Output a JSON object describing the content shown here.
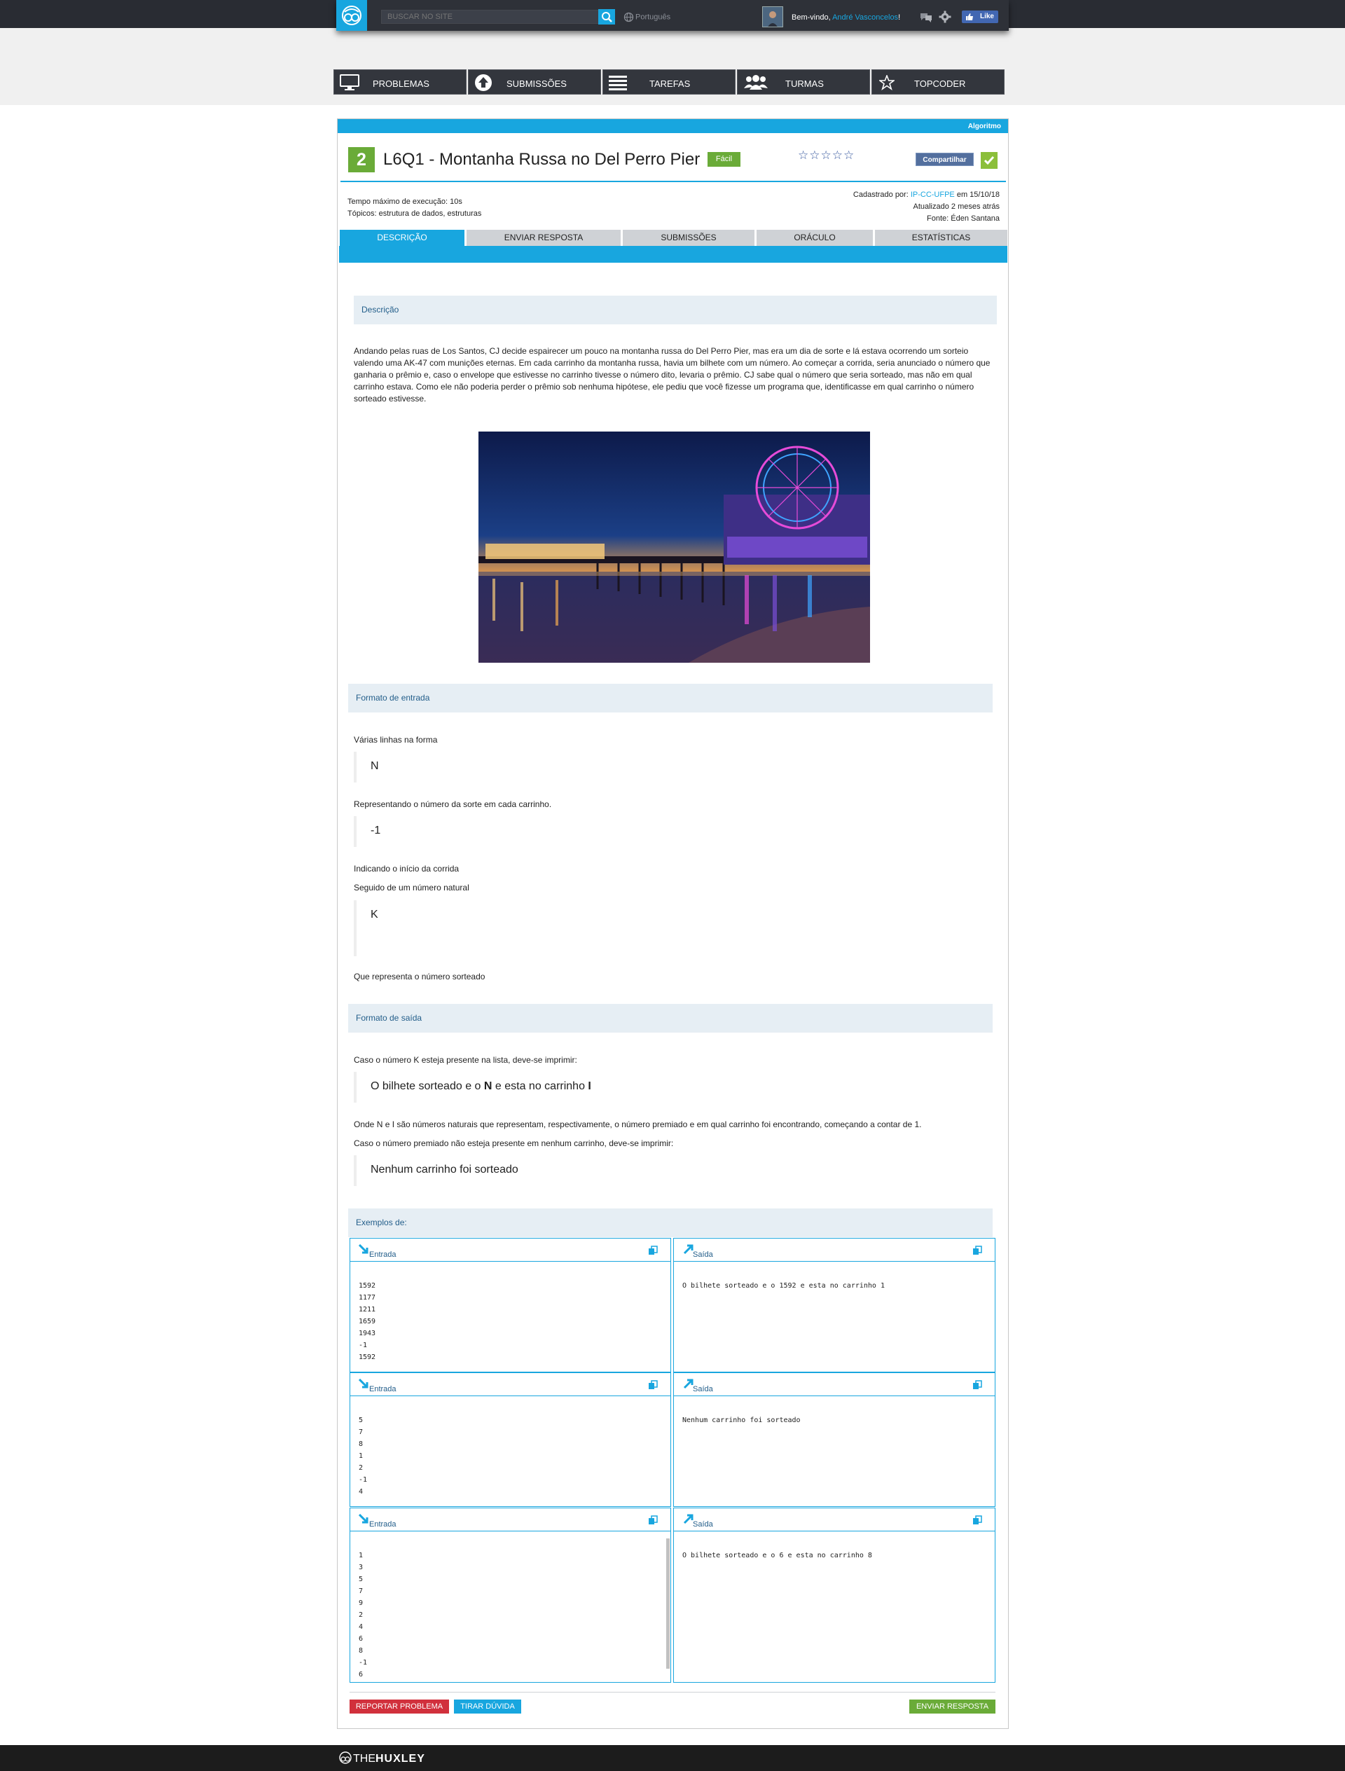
{
  "header": {
    "search_placeholder": "BUSCAR NO SITE",
    "language": "Português",
    "welcome_prefix": "Bem-vindo, ",
    "user_name": "André Vasconcelos",
    "welcome_suffix": "!",
    "like_label": "Like"
  },
  "nav": [
    {
      "label": "PROBLEMAS",
      "icon": "monitor-icon"
    },
    {
      "label": "SUBMISSÕES",
      "icon": "upload-icon"
    },
    {
      "label": "TAREFAS",
      "icon": "list-icon"
    },
    {
      "label": "TURMAS",
      "icon": "group-icon"
    },
    {
      "label": "TOPCODER",
      "icon": "star-icon"
    }
  ],
  "problem": {
    "category": "Algoritmo",
    "number": "2",
    "title": "L6Q1 - Montanha Russa no Del Perro Pier",
    "difficulty": "Fácil",
    "stars": "☆☆☆☆☆",
    "share_label": "Compartilhar",
    "time_limit": "Tempo máximo de execução: 10s",
    "topics": "Tópicos: estrutura de dados, estruturas",
    "registered_prefix": "Cadastrado por: ",
    "registered_by": "IP-CC-UFPE",
    "registered_suffix": " em 15/10/18",
    "updated": "Atualizado 2 meses atrás",
    "source": "Fonte: Éden Santana"
  },
  "tabs": [
    {
      "label": "DESCRIÇÃO",
      "active": true
    },
    {
      "label": "ENVIAR RESPOSTA",
      "active": false
    },
    {
      "label": "SUBMISSÕES",
      "active": false
    },
    {
      "label": "ORÁCULO",
      "active": false
    },
    {
      "label": "ESTATÍSTICAS",
      "active": false
    }
  ],
  "description": {
    "heading": "Descrição",
    "lines": [
      "Andando pelas ruas de Los Santos, CJ decide espairecer um pouco na montanha russa do Del Perro Pier, mas era um dia de sorte e lá estava ocorrendo um sorteio",
      "valendo uma AK-47 com munições eternas. Em cada carrinho da montanha russa, havia um bilhete com um número. Ao começar a corrida, seria anunciado o número que",
      "ganharia o prêmio e, caso o envelope que estivesse no carrinho tivesse o número dito, levaria o prêmio. CJ  sabe qual o número que seria sorteado, mas não em qual",
      "carrinho estava. Como ele não poderia perder o prêmio sob nenhuma hipótese, ele pediu que você fizesse um programa que, identificasse em qual carrinho o número",
      "sorteado estivesse."
    ]
  },
  "input_format": {
    "heading": "Formato de entrada",
    "line1": "Várias linhas na forma",
    "q1": "N",
    "line2": "Representando o número da sorte em cada carrinho.",
    "q2": "-1",
    "line3": "Indicando o início da corrida",
    "line4": "Seguido de um número natural",
    "q3": "K",
    "line5": "Que representa o número sorteado"
  },
  "output_format": {
    "heading": "Formato de saída",
    "line1": "Caso o número K esteja presente na lista, deve-se imprimir:",
    "q1_a": "O bilhete sorteado e o ",
    "q1_b": "N",
    "q1_c": " e esta no carrinho ",
    "q1_d": "I",
    "line2": "Onde N e I são números naturais que representam, respectivamente, o número premiado e em qual carrinho foi encontrando, começando a contar de 1.",
    "line3": "Caso o número premiado não esteja presente em nenhum carrinho, deve-se imprimir:",
    "q2": "Nenhum carrinho foi sorteado"
  },
  "examples": {
    "heading": "Exemplos de:",
    "input_label": "Entrada",
    "output_label": "Saída",
    "items": [
      {
        "input": "1592\n1177\n1211\n1659\n1943\n-1\n1592",
        "output": "O bilhete sorteado e o 1592 e esta no carrinho 1"
      },
      {
        "input": "5\n7\n8\n1\n2\n-1\n4",
        "output": "Nenhum carrinho foi sorteado"
      },
      {
        "input": "1\n3\n5\n7\n9\n2\n4\n6\n8\n-1\n6",
        "output": "O bilhete sorteado e o 6 e esta no carrinho 8"
      }
    ]
  },
  "actions": {
    "report": "REPORTAR PROBLEMA",
    "question": "TIRAR DÚVIDA",
    "submit": "ENVIAR RESPOSTA"
  },
  "footer": {
    "brand_a": "THE",
    "brand_b": "HUXLEY"
  },
  "colors": {
    "accent": "#18a6df",
    "success": "#6aab38",
    "danger": "#d1303c",
    "header": "#292c33"
  }
}
